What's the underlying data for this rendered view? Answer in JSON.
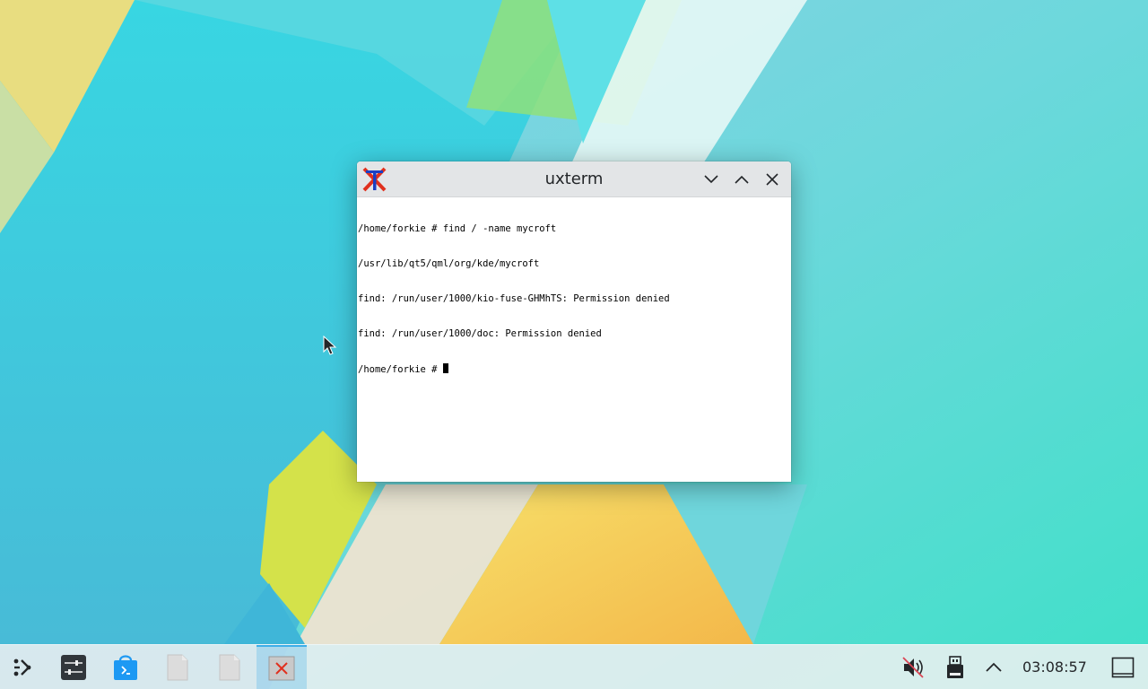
{
  "window": {
    "title": "uxterm",
    "icon": "xterm-icon"
  },
  "terminal": {
    "lines": [
      "/home/forkie # find / -name mycroft",
      "/usr/lib/qt5/qml/org/kde/mycroft",
      "find: /run/user/1000/kio-fuse-GHMhTS: Permission denied",
      "find: /run/user/1000/doc: Permission denied"
    ],
    "prompt": "/home/forkie # "
  },
  "taskbar": {
    "launcher_icon": "application-launcher-icon",
    "tasks": [
      {
        "icon": "system-settings-icon"
      },
      {
        "icon": "discover-store-icon"
      },
      {
        "icon": "file-document-icon"
      },
      {
        "icon": "file-document-icon"
      },
      {
        "icon": "xterm-icon"
      }
    ],
    "tray": {
      "volume_icon": "audio-muted-icon",
      "device_icon": "usb-device-icon",
      "expand_icon": "chevron-up-icon",
      "clock": "03:08:57",
      "show_desktop_icon": "show-desktop-icon"
    }
  },
  "colors": {
    "accent": "#3daee9",
    "titlebar": "#e3e5e7",
    "terminal_bg": "#ffffff"
  }
}
